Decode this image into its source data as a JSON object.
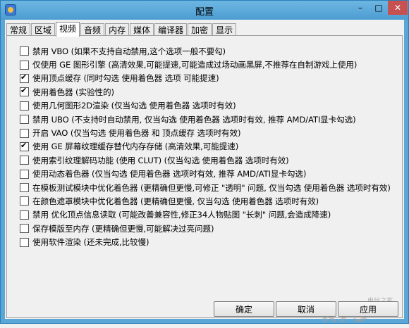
{
  "window": {
    "title": "配置"
  },
  "titlebar": {
    "minimize": "–",
    "maximize": "□",
    "close": "✕"
  },
  "tabs": [
    {
      "label": "常规",
      "active": false
    },
    {
      "label": "区域",
      "active": false
    },
    {
      "label": "视频",
      "active": true
    },
    {
      "label": "音频",
      "active": false
    },
    {
      "label": "内存",
      "active": false
    },
    {
      "label": "媒体",
      "active": false
    },
    {
      "label": "编译器",
      "active": false
    },
    {
      "label": "加密",
      "active": false
    },
    {
      "label": "显示",
      "active": false
    }
  ],
  "options": [
    {
      "label": "禁用 VBO (如果不支持自动禁用,这个选项一般不要勾)",
      "checked": false
    },
    {
      "label": "仅使用 GE 图形引擎 (高清效果,可能提速,可能造成过场动画黑屏,不推荐在自制游戏上使用)",
      "checked": false
    },
    {
      "label": "使用顶点缓存 (同时勾选 使用着色器 选项 可能提速)",
      "checked": true
    },
    {
      "label": "使用着色器 (实验性的)",
      "checked": true
    },
    {
      "label": "使用几何图形2D渲染 (仅当勾选 使用着色器 选项时有效)",
      "checked": false
    },
    {
      "label": "禁用 UBO (不支持时自动禁用, 仅当勾选 使用着色器 选项时有效, 推荐 AMD/ATI显卡勾选)",
      "checked": false
    },
    {
      "label": "开启 VAO (仅当勾选 使用着色器 和 顶点缓存 选项时有效)",
      "checked": false
    },
    {
      "label": "使用 GE 屏幕纹理缓存替代内存存储 (高清效果,可能提速)",
      "checked": true
    },
    {
      "label": "使用索引纹理解码功能 (使用 CLUT) (仅当勾选 使用着色器 选项时有效)",
      "checked": false
    },
    {
      "label": "使用动态着色器 (仅当勾选 使用着色器 选项时有效, 推荐 AMD/ATI显卡勾选)",
      "checked": false
    },
    {
      "label": "在模板测试模块中优化着色器 (更精确但更慢,可修正 \"透明\" 问题, 仅当勾选 使用着色器 选项时有效)",
      "checked": false
    },
    {
      "label": "在颜色遮罩模块中优化着色器 (更精确但更慢, 仅当勾选 使用着色器 选项时有效)",
      "checked": false
    },
    {
      "label": "禁用 优化顶点信息读取 (可能改善兼容性,修正34人物贴图 \"长刺\" 问题,会造成降速)",
      "checked": false
    },
    {
      "label": "保存模版至内存 (更精确但更慢,可能解决过亮问题)",
      "checked": false
    },
    {
      "label": "使用软件渲染 (还未完成,比较慢)",
      "checked": false
    }
  ],
  "buttons": {
    "ok": "确定",
    "cancel": "取消",
    "apply": "应用"
  },
  "watermark": {
    "logo": "k73",
    "sub": "电玩之家"
  }
}
